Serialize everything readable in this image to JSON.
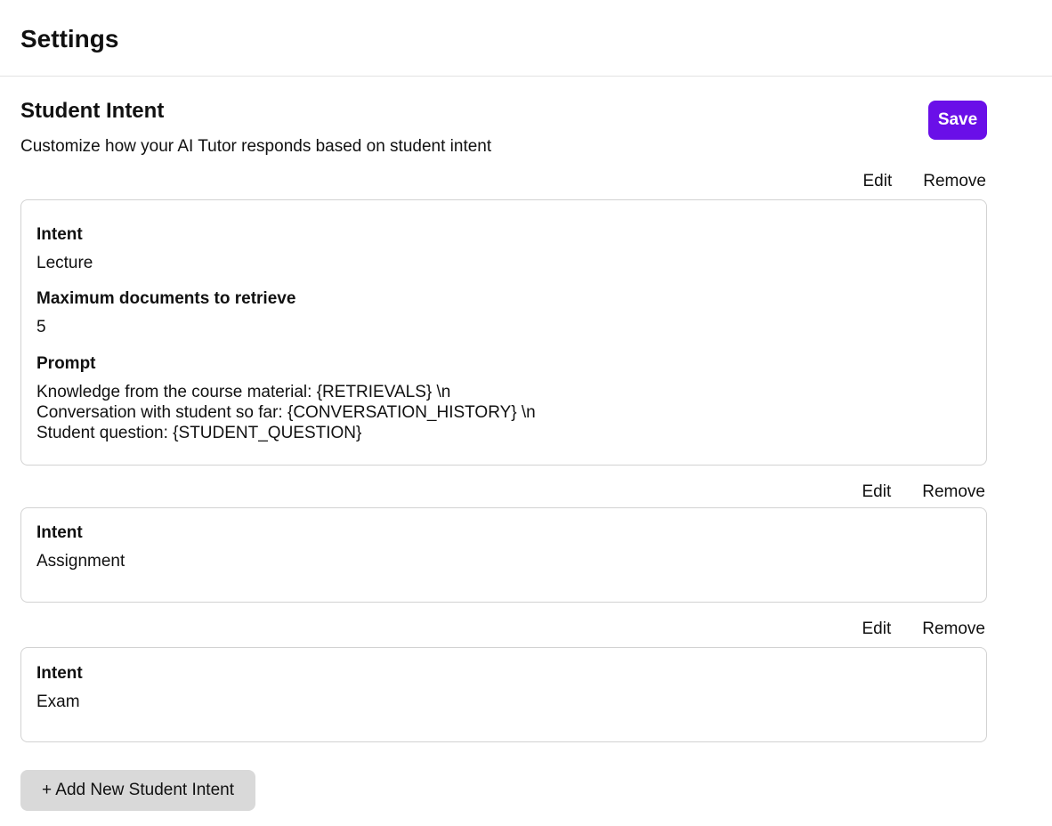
{
  "header": {
    "title": "Settings"
  },
  "section": {
    "title": "Student Intent",
    "description": "Customize how your AI Tutor responds based on student intent",
    "save_label": "Save"
  },
  "intents": [
    {
      "edit_label": "Edit",
      "remove_label": "Remove",
      "intent_label": "Intent",
      "intent_value": "Lecture",
      "max_docs_label": "Maximum documents to retrieve",
      "max_docs_value": "5",
      "prompt_label": "Prompt",
      "prompt_lines": [
        "Knowledge from the course material: {RETRIEVALS} \\n",
        "Conversation with student so far: {CONVERSATION_HISTORY} \\n",
        "Student question: {STUDENT_QUESTION}"
      ]
    },
    {
      "edit_label": "Edit",
      "remove_label": "Remove",
      "intent_label": "Intent",
      "intent_value": "Assignment"
    },
    {
      "edit_label": "Edit",
      "remove_label": "Remove",
      "intent_label": "Intent",
      "intent_value": "Exam"
    }
  ],
  "add_button_label": "+ Add New Student Intent",
  "colors": {
    "accent": "#6a0fe8",
    "secondary_button": "#d9d9d9",
    "border": "#d2d2d2"
  }
}
